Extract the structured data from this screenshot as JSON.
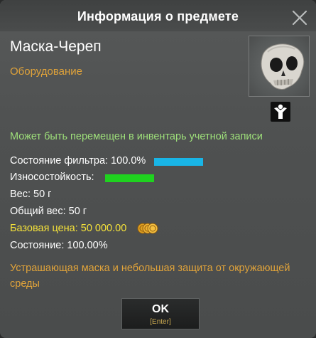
{
  "window": {
    "title": "Информация о предмете",
    "close_icon": "close-icon"
  },
  "item": {
    "name": "Маска-Череп",
    "category": "Оборудование",
    "image_icon": "skull-mask-icon",
    "badge_icon": "person-icon",
    "transfer_note": "Может быть перемещен в инвентарь учетной записи"
  },
  "stats": {
    "filter_label": "Состояние фильтра:",
    "filter_value": "100.0%",
    "filter_fraction": 1.0,
    "durability_label": "Износостойкость:",
    "durability_fraction": 1.0,
    "weight_label": "Вес:",
    "weight_value": "50 г",
    "total_weight_label": "Общий вес:",
    "total_weight_value": "50 г",
    "price_label": "Базовая цена:",
    "price_value": "50 000.00",
    "price_icon": "coins-icon",
    "condition_label": "Состояние:",
    "condition_value": "100.00%"
  },
  "description": "Устрашающая маска и небольшая защита от окружающей среды",
  "ok_button": {
    "label": "OK",
    "hint": "[Enter]"
  },
  "colors": {
    "category": "#e0a33a",
    "transfer_note": "#9ee07a",
    "filter_bar": "#19b5e6",
    "durability_bar": "#1fd21f",
    "price": "#f5e23a",
    "description": "#e0a33a"
  }
}
